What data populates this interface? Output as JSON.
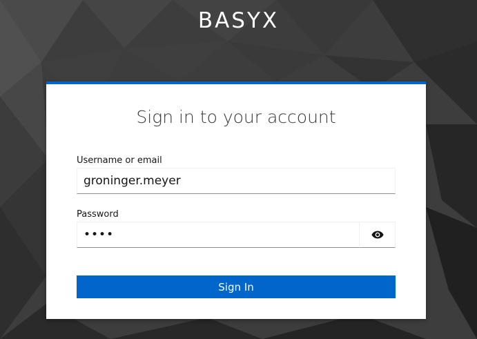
{
  "brand": {
    "name": "BASYX"
  },
  "login": {
    "title": "Sign in to your account",
    "username_label": "Username or email",
    "username_value": "groninger.meyer",
    "password_label": "Password",
    "password_value": "••••",
    "show_password_icon": "eye-icon",
    "submit_label": "Sign In"
  },
  "colors": {
    "accent": "#0066cc",
    "background": "#3a3a3a",
    "card": "#ffffff"
  }
}
